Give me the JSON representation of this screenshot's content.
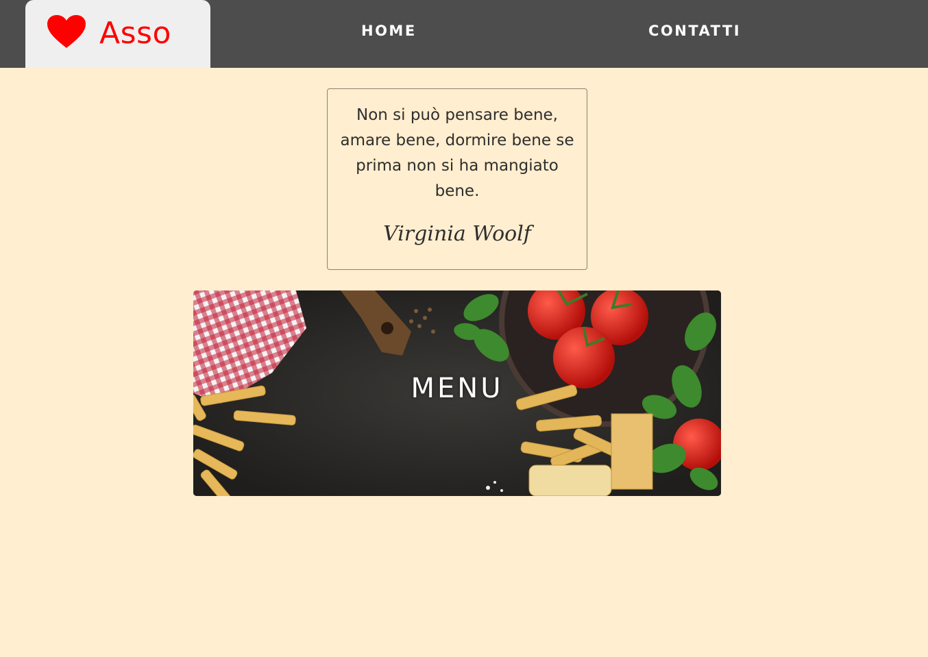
{
  "brand": {
    "name": "Asso",
    "icon": "heart-icon",
    "color": "#ff0000"
  },
  "nav": {
    "home": "HOME",
    "contatti": "CONTATTI"
  },
  "quote": {
    "text": "Non si può pensare bene, amare bene, dormire bene se prima non si ha mangiato bene.",
    "author": "Virginia Woolf"
  },
  "menu_card": {
    "label": "MENU"
  },
  "colors": {
    "page_bg": "#ffeecf",
    "topbar": "#4d4d4d",
    "brand_bg": "#efefef"
  }
}
